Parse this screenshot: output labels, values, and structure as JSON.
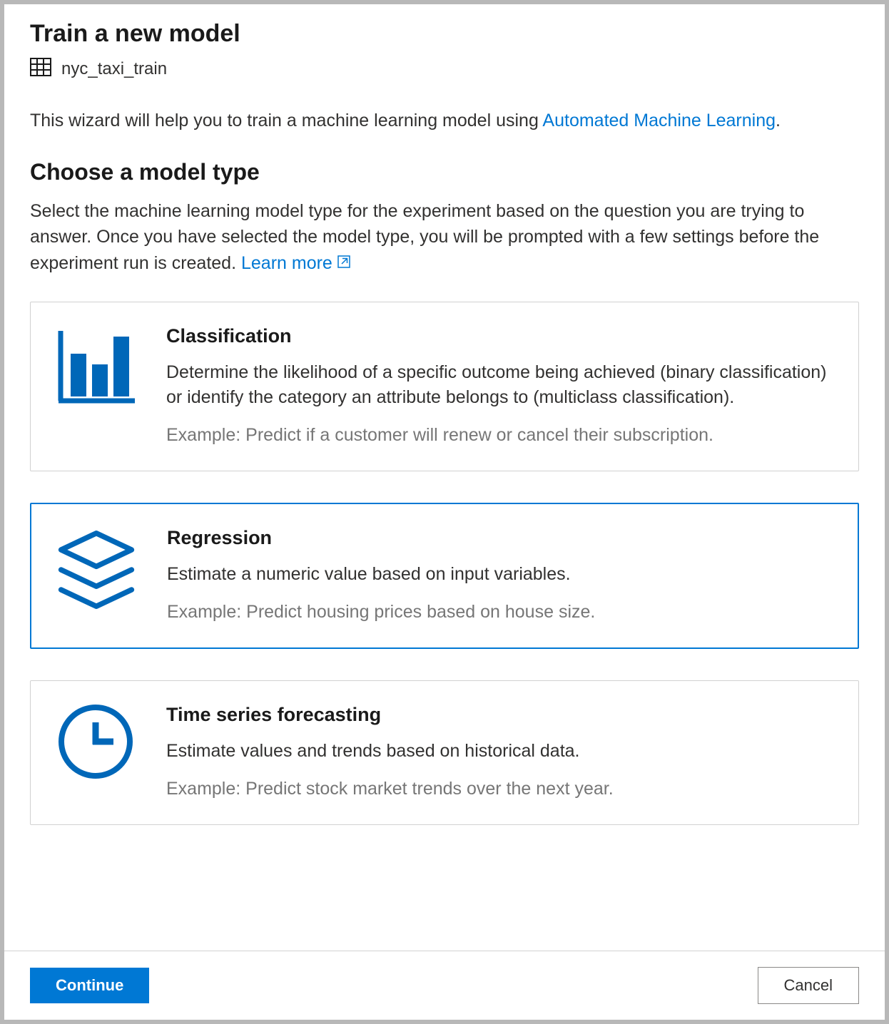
{
  "header": {
    "title": "Train a new model",
    "dataset": "nyc_taxi_train"
  },
  "intro": {
    "prefix": "This wizard will help you to train a machine learning model using ",
    "link_text": "Automated Machine Learning",
    "suffix": "."
  },
  "section": {
    "title": "Choose a model type",
    "desc_prefix": "Select the machine learning model type for the experiment based on the question you are trying to answer. Once you have selected the model type, you will be prompted with a few settings before the experiment run is created. ",
    "learn_more": "Learn more"
  },
  "cards": [
    {
      "title": "Classification",
      "desc": "Determine the likelihood of a specific outcome being achieved (binary classification) or identify the category an attribute belongs to (multiclass classification).",
      "example": "Example: Predict if a customer will renew or cancel their subscription.",
      "selected": false
    },
    {
      "title": "Regression",
      "desc": "Estimate a numeric value based on input variables.",
      "example": "Example: Predict housing prices based on house size.",
      "selected": true
    },
    {
      "title": "Time series forecasting",
      "desc": "Estimate values and trends based on historical data.",
      "example": "Example: Predict stock market trends over the next year.",
      "selected": false
    }
  ],
  "footer": {
    "continue": "Continue",
    "cancel": "Cancel"
  }
}
